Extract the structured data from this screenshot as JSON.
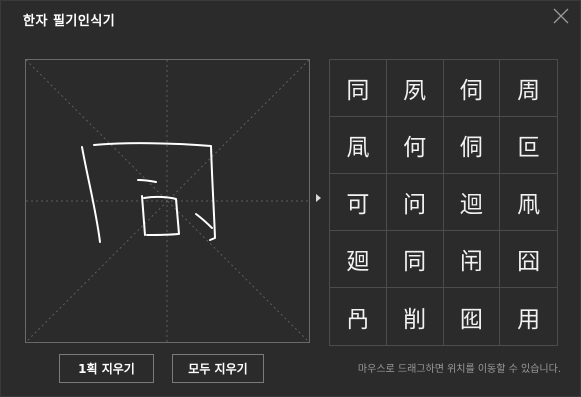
{
  "window": {
    "title": "한자 필기인식기"
  },
  "candidates": [
    "同",
    "夙",
    "伺",
    "周",
    "凬",
    "何",
    "侗",
    "叵",
    "可",
    "问",
    "迴",
    "凧",
    "廻",
    "同",
    "闬",
    "囧",
    "冎",
    "削",
    "囮",
    "用"
  ],
  "buttons": {
    "clear_stroke": "1획 지우기",
    "clear_all": "모두 지우기"
  },
  "hint": "마우스로 드래그하면 위치를 이동할 수 있습니다.",
  "colors": {
    "background": "#2b2b2b",
    "stroke": "#ffffff",
    "guide": "#6a6a6a"
  }
}
